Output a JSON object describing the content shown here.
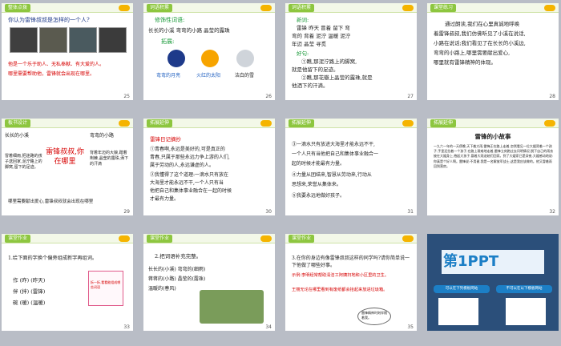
{
  "slides": [
    {
      "num": "25",
      "tag": "整体点拨",
      "question": "你认为雷锋叔叔是怎样的一个人?",
      "line1": "他是一个乐于助人、无私奉献、有大爱的人。",
      "line2": "哪里需要帮助他，雷锋就会出现在哪里。"
    },
    {
      "num": "26",
      "tag": "词语积累",
      "heading": "修饰性词语:",
      "phrases": "长长的小溪 弯弯的小路 晶莹的露珠",
      "expand": "拓展:",
      "moon": "弯弯的月亮",
      "sun": "火红的太阳",
      "stone": "洁白的雪"
    },
    {
      "num": "27",
      "tag": "词语积累",
      "newwords": "新词:",
      "words1": "雷锋 昨天 冒着 留下 弯",
      "words2": "弯的 背着 泥泞 温暖 泥泞",
      "words3": "年迈 晶莹 寻觅",
      "goodsent": "好句:",
      "sent1": "①瞧,那泥泞路上的脚窝,",
      "sent2": "就是他留下的足迹。",
      "sent3": "②瞧,那花瓣上晶莹的露珠,就是",
      "sent4": "他洒下的汗滴。"
    },
    {
      "num": "28",
      "tag": "课堂练习",
      "p1": "通过朗读,我们在心里真诚地呼唤",
      "p2": "着雷锋叔叔,我们仿佛听见了小溪在说话,",
      "p3": "小路在说话;我们看见了在长长的小溪边,",
      "p4": "弯弯的小路上,哪里需要献出爱心,",
      "p5": "哪里就有雷锋精神的体现。"
    },
    {
      "num": "29",
      "tag": "板书设计",
      "center": "雷锋叔叔,你在哪里",
      "left1": "长长的小溪",
      "right1": "弯弯的小路",
      "left2": "冒着细雨,把迷路的孩子送回家,泥泞路上的脚窝,留下的足迹。",
      "right2": "背着年迈的大娘,踏着荆棘,晶莹的露珠,洒下的汗滴",
      "bottom": "哪里需要献出爱心,雷锋叔叔就会出现在哪里"
    },
    {
      "num": "30",
      "tag": "拓展延伸",
      "heading": "雷锋日记摘抄",
      "l1": "①青春啊,永远是美好的,可是真正的",
      "l2": "青春,只属于那些永远力争上游的人们,",
      "l3": "属于劳动的人,永远谦虚的人。",
      "l4": "②我懂得了这个道理:一滴水只有放在",
      "l5": "大海里才能永远不干,一个人只有当",
      "l6": "他把自己和集体事业融合在一起的时候",
      "l7": "才最有力量。"
    },
    {
      "num": "31",
      "tag": "拓展延伸",
      "l1": "③一滴水只有放进大海里才能永远不干,",
      "l2": "一个人只有当他把自己和集体事业融合一",
      "l3": "起的时候才能最有力量。",
      "l4": "④力量从团结来,智慧从劳动来,行动从",
      "l5": "思想来,荣誉从集体来。",
      "l6": "⑤我要永远地做好孩子。"
    },
    {
      "num": "32",
      "tag": "拓展延伸",
      "title": "雷锋的小故事",
      "body": "一九六一年的一天傍晚,天下着大雨,雷锋正在路上走着,忽然看见一位大嫂背着一个孩子,手里还拉着一个孩子,在路上艰难地走着,雷锋立刻跑过去问明情况,脱下自己的雨衣披在大嫂身上,抱起大孩子,冒着大雨送她们回家。到了大嫂家已是深夜,大嫂感动地说:你真是个好人啊。雷锋说:不用谢,我是一名解放军战士,这是我应该做的。他又冒着雨回到营房。"
    },
    {
      "num": "33",
      "tag": "课堂作业",
      "task": "1.给下面的字换个偏旁组成新字再组词。",
      "chars": [
        "作 (昨) (昨天)",
        "伴 (拌) (雷锋)",
        "碗 (暖) (温暖)"
      ],
      "tip": "拆一拆,看看能组成哪些词语"
    },
    {
      "num": "34",
      "tag": "课堂作业",
      "task": "2.把词语补充完整。",
      "rows": [
        "长长的(小溪)  弯弯的(细雨)",
        "蒋蒋的(小路)  晶莹的(露珠)",
        "温暖的(春风)"
      ]
    },
    {
      "num": "35",
      "tag": "课堂作业",
      "task": "3.在你的身边有像雷锋叔叔这样的同学吗?请你简单说一下他做了哪些好事。",
      "ex": "示例:李明经常帮助清洁工阿姨扫地和小区里的卫生。",
      "ex2": "王丽无论在哪里看到有废纸都会拾起来放进垃圾箱。",
      "bubble": "雷锋精神时刻伴随着我。"
    },
    {
      "num": "36",
      "brand": "第1PPT",
      "sub1": "可以在下列模板网站",
      "sub2": "不可以在以下模板网站"
    }
  ]
}
